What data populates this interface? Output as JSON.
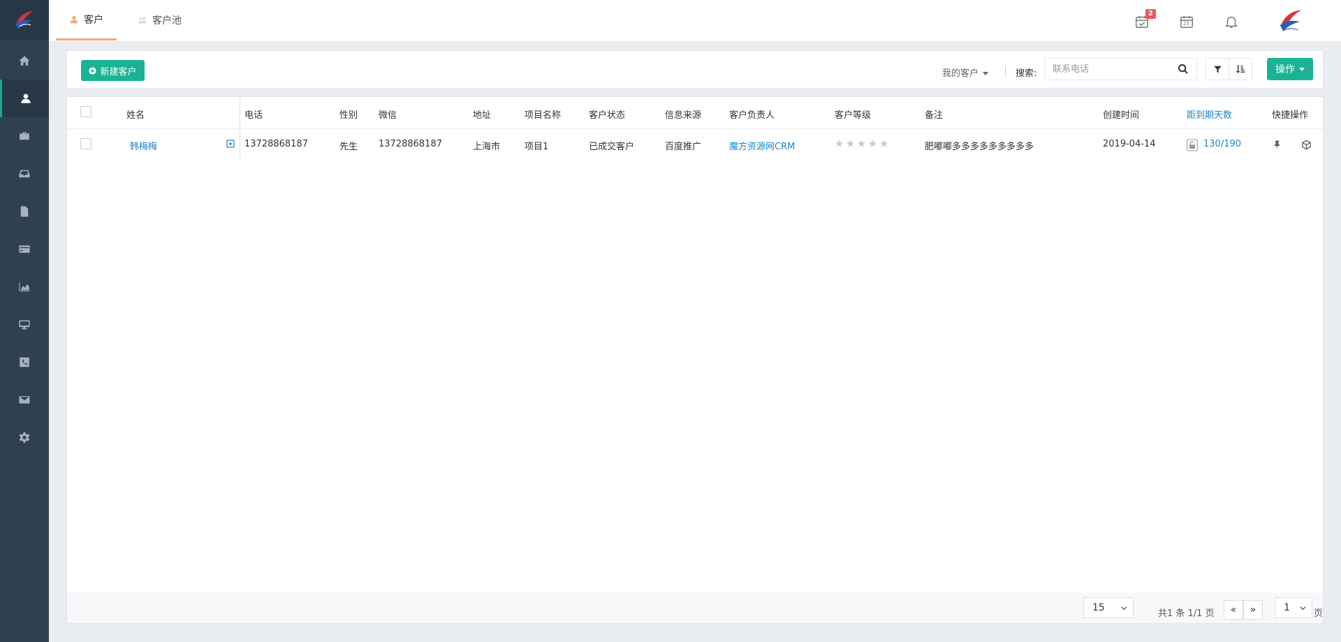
{
  "brand": {
    "logo_icon": "ribbon-logo-icon"
  },
  "sidebar": {
    "items": [
      {
        "key": "home",
        "icon": "home-icon"
      },
      {
        "key": "customers",
        "icon": "user-icon",
        "active": true
      },
      {
        "key": "briefcase",
        "icon": "briefcase-icon"
      },
      {
        "key": "inbox",
        "icon": "inbox-icon"
      },
      {
        "key": "documents",
        "icon": "file-icon"
      },
      {
        "key": "billing",
        "icon": "credit-card-icon"
      },
      {
        "key": "reports",
        "icon": "area-chart-icon"
      },
      {
        "key": "desktop",
        "icon": "desktop-icon"
      },
      {
        "key": "phone",
        "icon": "phone-icon"
      },
      {
        "key": "mail",
        "icon": "envelope-icon"
      },
      {
        "key": "settings",
        "icon": "gear-icon"
      }
    ]
  },
  "tabs": [
    {
      "label": "客户",
      "icon": "user-icon",
      "active": true
    },
    {
      "label": "客户池",
      "icon": "users-icon",
      "active": false
    }
  ],
  "header": {
    "task_badge": "2",
    "calendar_day": "25",
    "icons": [
      "calendar-check-icon",
      "calendar-icon",
      "bell-icon"
    ]
  },
  "toolbar": {
    "new_customer_label": "新建客户",
    "scope_label": "我的客户",
    "search_label": "搜索:",
    "search_placeholder": "联系电话",
    "actions_label": "操作"
  },
  "table": {
    "columns": [
      "姓名",
      "电话",
      "性别",
      "微信",
      "地址",
      "项目名称",
      "客户状态",
      "信息来源",
      "客户负责人",
      "客户等级",
      "备注",
      "创建时间",
      "距到期天数",
      "快捷操作"
    ],
    "rows": [
      {
        "name": "韩梅梅",
        "phone": "13728868187",
        "gender": "先生",
        "wechat": "13728868187",
        "address": "上海市",
        "project": "项目1",
        "status": "已成交客户",
        "source": "百度推广",
        "owner": "魔方资源网CRM",
        "rating": 0,
        "rating_max": 5,
        "note": "肥嘟嘟多多多多多多多多多",
        "created": "2019-04-14",
        "days_left": "130/190"
      }
    ]
  },
  "footer": {
    "page_size": "15",
    "summary": "共1 条 1/1 页",
    "prev": "«",
    "next": "»",
    "page": "1",
    "page_suffix": "页"
  },
  "colors": {
    "sidebar_bg": "#2f4050",
    "primary": "#1ab394",
    "link": "#1c84c6",
    "tab_underline": "#f5a77c",
    "badge": "#ed5565"
  }
}
